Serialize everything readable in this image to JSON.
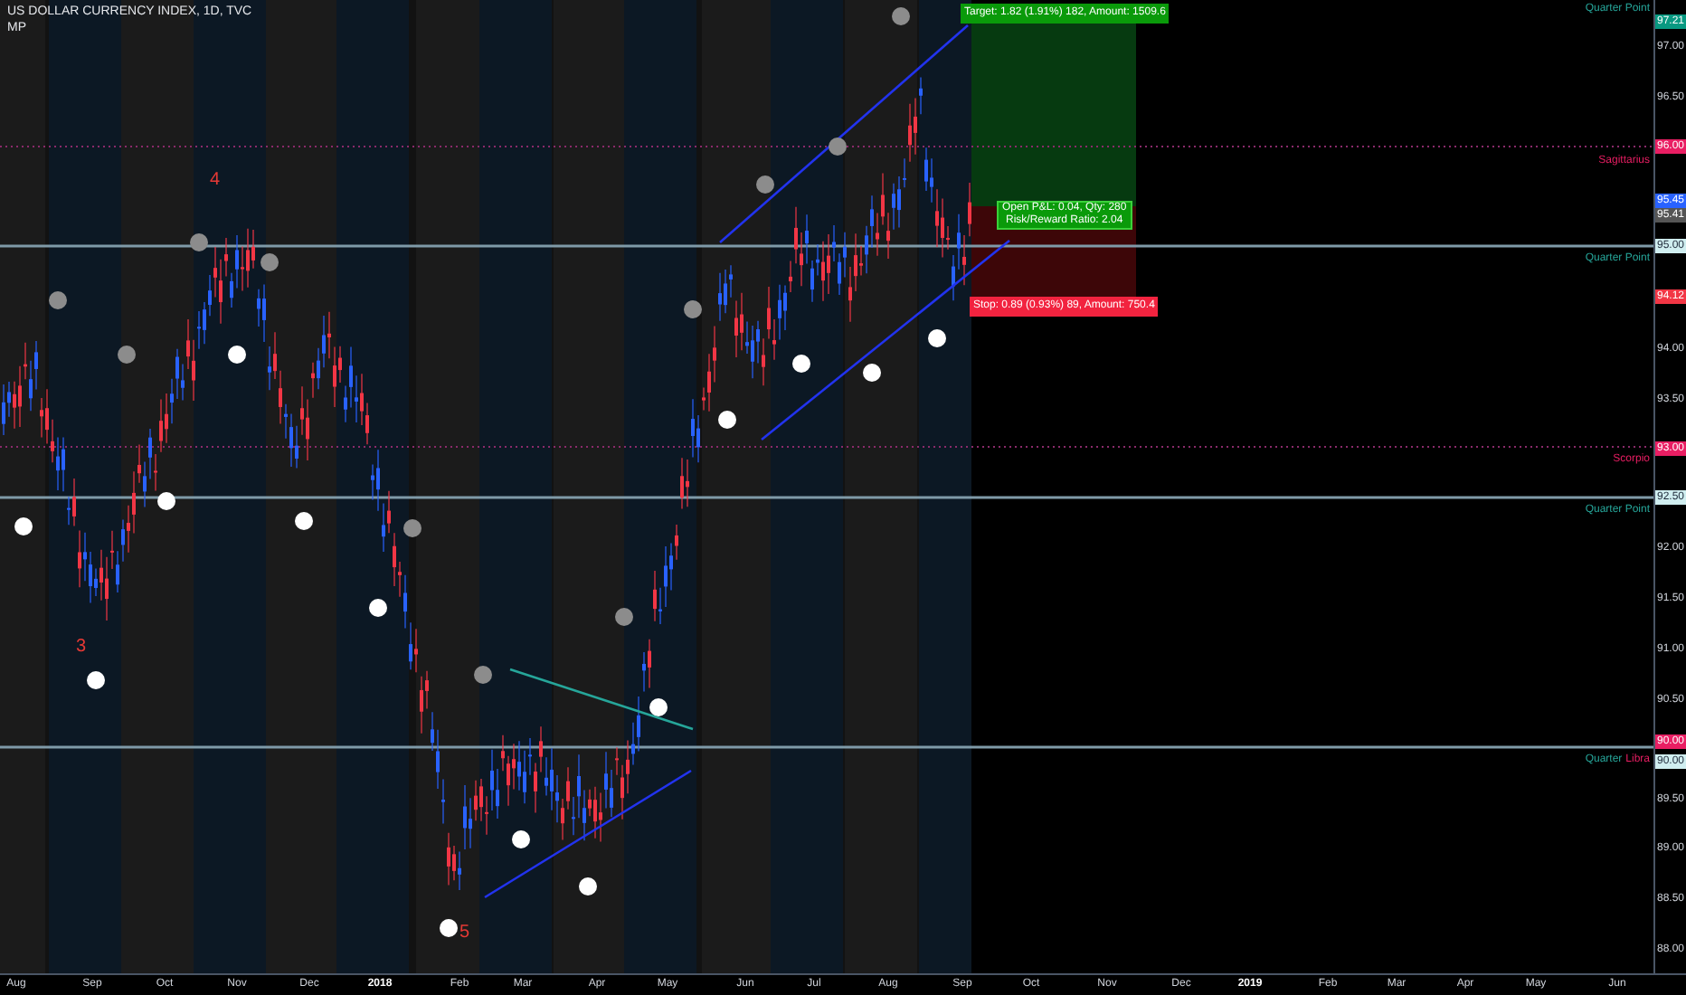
{
  "chart": {
    "title": "US DOLLAR CURRENCY INDEX, 1D, TVC",
    "indicator": "MP",
    "wave_labels": [
      {
        "text": "4"
      },
      {
        "text": "3"
      },
      {
        "text": "5"
      }
    ],
    "level_labels": [
      {
        "text": "Quarter Point",
        "color": "#26a69a"
      },
      {
        "text": "Sagittarius",
        "color": "#e91e63"
      },
      {
        "text": "Quarter Point",
        "color": "#26a69a"
      },
      {
        "text": "Scorpio",
        "color": "#e91e63"
      },
      {
        "text": "Quarter Point",
        "color": "#26a69a"
      },
      {
        "text": "Quarter",
        "color": "#26a69a"
      },
      {
        "text": "Libra",
        "color": "#e91e63"
      }
    ],
    "position": {
      "target": "Target: 1.82 (1.91%) 182, Amount: 1509.6",
      "open_pnl": "Open P&L: 0.04, Qty: 280",
      "risk_reward": "Risk/Reward Ratio: 2.04",
      "stop": "Stop: 0.89 (0.93%) 89, Amount: 750.4"
    }
  },
  "price_axis": [
    {
      "text": "97.21",
      "kind": "tag",
      "color": "#089981"
    },
    {
      "text": "97.00",
      "kind": "plain"
    },
    {
      "text": "96.50",
      "kind": "plain"
    },
    {
      "text": "96.00",
      "kind": "tag",
      "color": "#e91e63"
    },
    {
      "text": "95.45",
      "kind": "tag",
      "color": "#2962ff"
    },
    {
      "text": "95.41",
      "kind": "tag",
      "color": "#555555"
    },
    {
      "text": "95.00",
      "kind": "tag",
      "color": "#d0eef0"
    },
    {
      "text": "94.12",
      "kind": "tag",
      "color": "#f23645"
    },
    {
      "text": "94.00",
      "kind": "plain"
    },
    {
      "text": "93.50",
      "kind": "plain"
    },
    {
      "text": "93.00",
      "kind": "tag",
      "color": "#e91e63"
    },
    {
      "text": "92.50",
      "kind": "tag",
      "color": "#d0eef0"
    },
    {
      "text": "92.00",
      "kind": "plain"
    },
    {
      "text": "91.50",
      "kind": "plain"
    },
    {
      "text": "91.00",
      "kind": "plain"
    },
    {
      "text": "90.50",
      "kind": "plain"
    },
    {
      "text": "90.00",
      "kind": "tag",
      "color": "#e91e63"
    },
    {
      "text": "90.00",
      "kind": "tag",
      "color": "#d0eef0"
    },
    {
      "text": "89.50",
      "kind": "plain"
    },
    {
      "text": "89.00",
      "kind": "plain"
    },
    {
      "text": "88.50",
      "kind": "plain"
    },
    {
      "text": "88.00",
      "kind": "plain"
    }
  ],
  "time_axis": [
    {
      "text": "Aug",
      "kind": "month"
    },
    {
      "text": "Sep",
      "kind": "month"
    },
    {
      "text": "Oct",
      "kind": "month"
    },
    {
      "text": "Nov",
      "kind": "month"
    },
    {
      "text": "Dec",
      "kind": "month"
    },
    {
      "text": "2018",
      "kind": "year"
    },
    {
      "text": "Feb",
      "kind": "month"
    },
    {
      "text": "Mar",
      "kind": "month"
    },
    {
      "text": "Apr",
      "kind": "month"
    },
    {
      "text": "May",
      "kind": "month"
    },
    {
      "text": "Jun",
      "kind": "month"
    },
    {
      "text": "Jul",
      "kind": "month"
    },
    {
      "text": "Aug",
      "kind": "month"
    },
    {
      "text": "Sep",
      "kind": "month"
    },
    {
      "text": "Oct",
      "kind": "month"
    },
    {
      "text": "Nov",
      "kind": "month"
    },
    {
      "text": "Dec",
      "kind": "month"
    },
    {
      "text": "2019",
      "kind": "year"
    },
    {
      "text": "Feb",
      "kind": "month"
    },
    {
      "text": "Mar",
      "kind": "month"
    },
    {
      "text": "Apr",
      "kind": "month"
    },
    {
      "text": "May",
      "kind": "month"
    },
    {
      "text": "Jun",
      "kind": "month"
    }
  ]
}
